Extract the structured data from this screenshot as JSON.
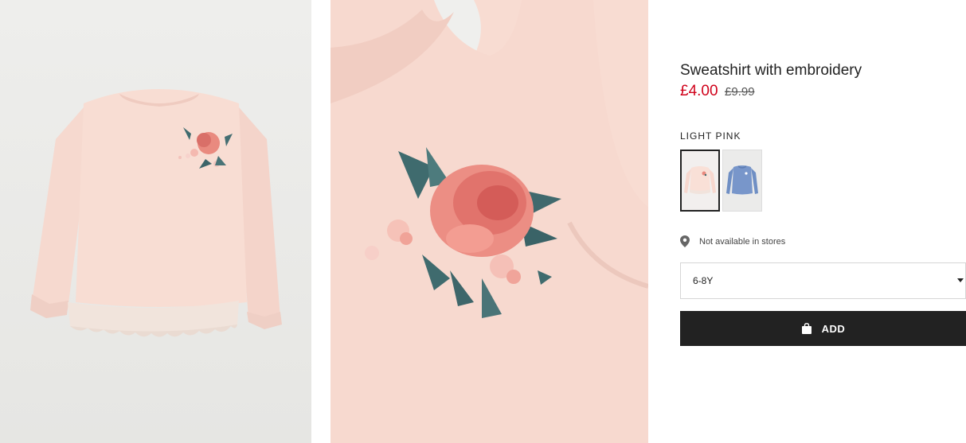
{
  "product": {
    "title": "Sweatshirt with embroidery",
    "price_sale": "£4.00",
    "price_original": "£9.99",
    "color_label": "LIGHT PINK",
    "swatches": [
      {
        "name": "light pink",
        "selected": true,
        "color": "#f7d8cf"
      },
      {
        "name": "blue",
        "selected": false,
        "color": "#6f8fc4"
      }
    ],
    "store_availability": "Not available in stores",
    "size": {
      "selected": "6-8Y"
    },
    "add_label": "ADD"
  },
  "colors": {
    "sale_red": "#d0021b",
    "button_bg": "#222222",
    "sweatshirt_pink": "#f7d8cf"
  },
  "icons": {
    "location": "location-pin-icon",
    "bag": "shopping-bag-icon",
    "dropdown": "chevron-down-icon"
  }
}
